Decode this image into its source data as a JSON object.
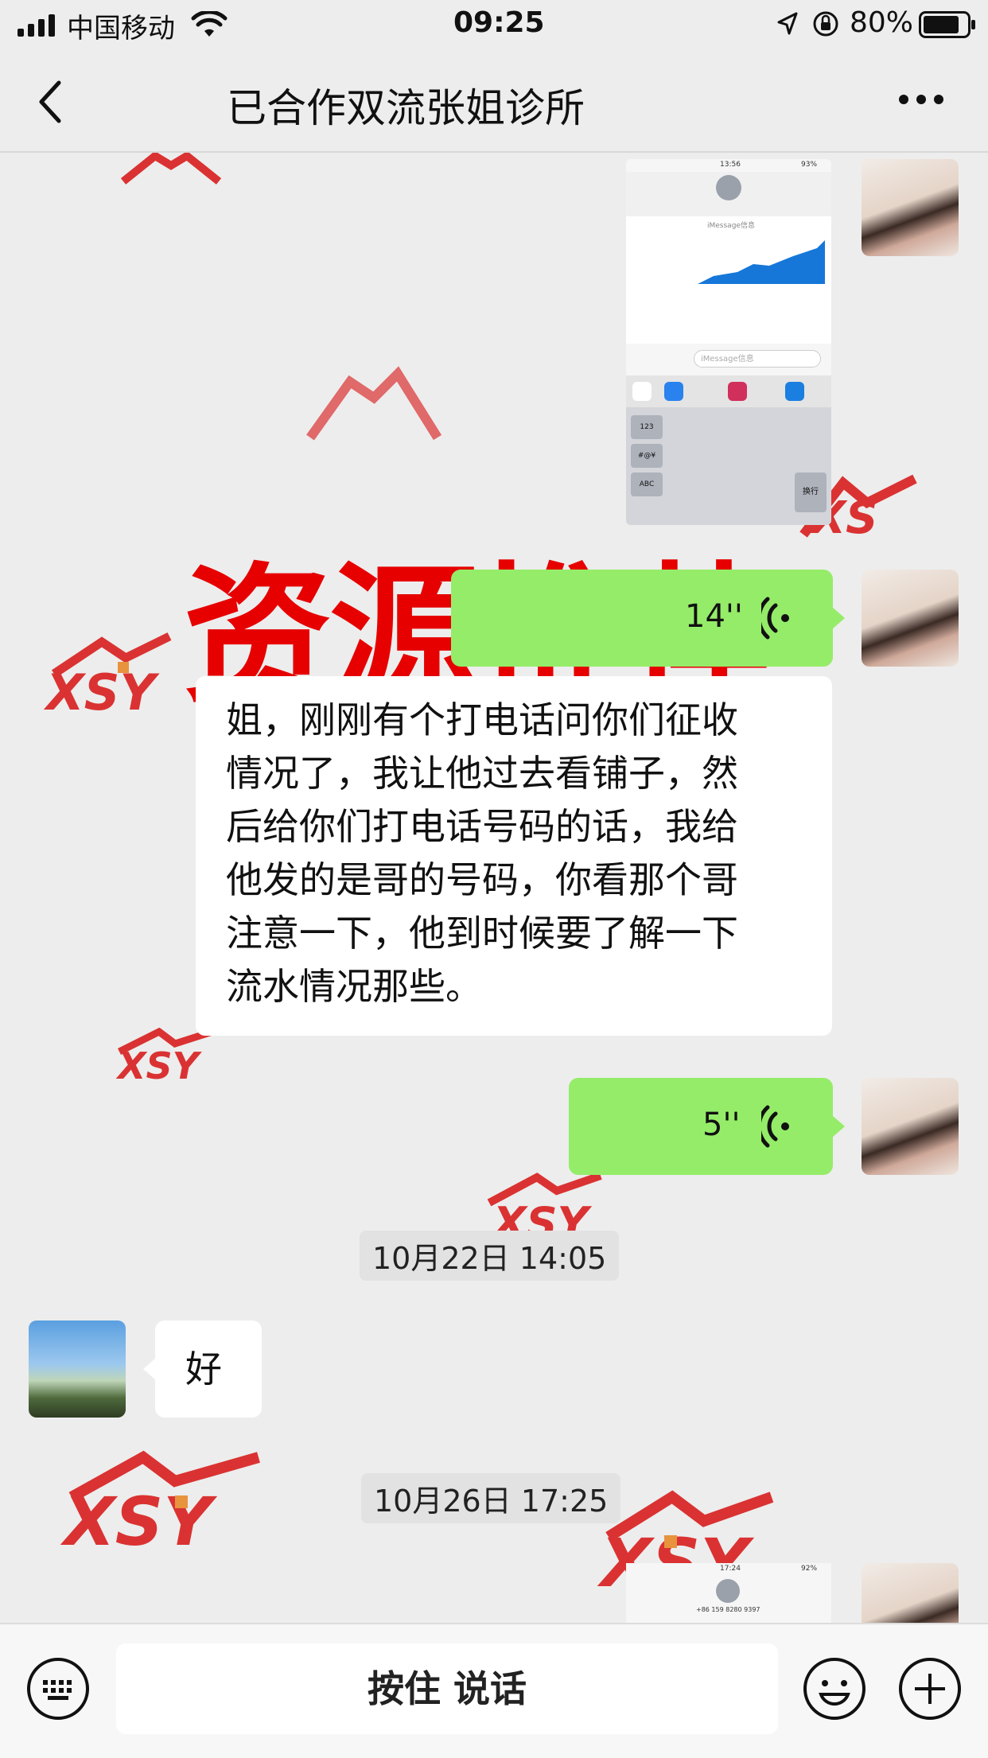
{
  "status_bar": {
    "carrier": "中国移动",
    "time": "09:25",
    "battery": "80%"
  },
  "nav": {
    "title": "已合作双流张姐诊所"
  },
  "overlay_text": "资源推荐",
  "messages": {
    "voice1": {
      "duration": "14''"
    },
    "text1": {
      "lines": [
        "姐，刚刚有个打电话问你们征收",
        "情况了，我让他过去看铺子，然",
        "后给你们打电话号码的话，我给",
        "他发的是哥的号码，你看那个哥",
        "注意一下，他到时候要了解一下",
        "流水情况那些。"
      ]
    },
    "voice2": {
      "duration": "5''"
    },
    "timestamp1": "10月22日 14:05",
    "reply": "好",
    "timestamp2": "10月26日 17:25"
  },
  "phone_screenshot": {
    "time": "13:56",
    "battery": "93%",
    "imessage_label": "iMessage信息",
    "input_placeholder": "iMessage信息",
    "return_key": "换行",
    "key_123": "123",
    "key_symbols": "#@¥",
    "key_abc": "ABC"
  },
  "phone_screenshot2": {
    "time": "17:24",
    "battery": "92%",
    "number": "+86 159 8280 9397"
  },
  "bottom": {
    "hold_to_talk": "按住 说话"
  },
  "colors": {
    "bubble_green": "#95ec69",
    "overlay_red": "#e60000",
    "watermark_red": "#d81e1e"
  }
}
